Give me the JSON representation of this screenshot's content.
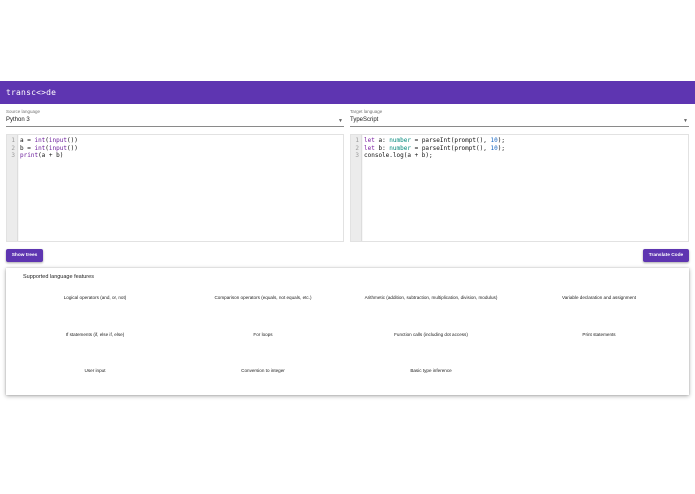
{
  "app": {
    "title": "transc<>de"
  },
  "source": {
    "label": "Source language",
    "value": "Python 3",
    "lines": [
      "1",
      "2",
      "3"
    ]
  },
  "target": {
    "label": "Target language",
    "value": "TypeScript",
    "lines": [
      "1",
      "2",
      "3"
    ]
  },
  "buttons": {
    "show_trees": "Show trees",
    "translate": "Translate Code"
  },
  "features": {
    "title": "Supported language features",
    "items": [
      "Logical operators (and, or, not)",
      "Comparison operators (equals, not equals, etc.)",
      "Arithmetic (addition, subtraction, multiplication, division, modulus)",
      "Variable declaration and assignment",
      "If statements (if, else if, else)",
      "For loops",
      "Function calls (including dot access)",
      "Print statements",
      "User input",
      "Conversion to integer",
      "Basic type inference"
    ]
  },
  "icons": {
    "dropdown": "chevron-down-icon"
  },
  "colors": {
    "primary": "#5e35b1",
    "keyword": "#7b1fa2",
    "type": "#00897b",
    "number": "#1565c0"
  }
}
